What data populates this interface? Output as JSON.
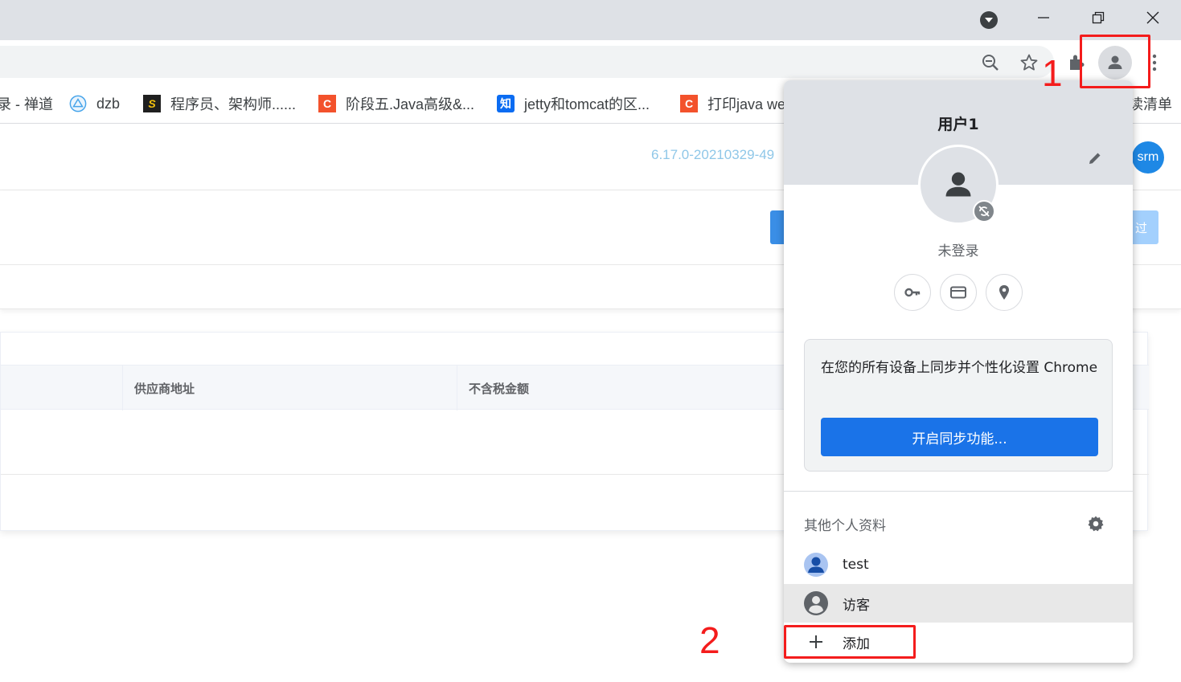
{
  "window_controls": {
    "minimize_icon": "minimize-icon",
    "restore_icon": "restore-icon",
    "close_icon": "close-icon",
    "tab_search_icon": "tab-search-icon"
  },
  "toolbar": {
    "zoom_icon": "zoom-out-icon",
    "bookmark_icon": "star-icon",
    "extensions_icon": "puzzle-icon",
    "profile_icon": "person-icon",
    "menu_icon": "kebab-menu-icon"
  },
  "bookmarks": [
    {
      "label": "录 - 禅道"
    },
    {
      "label": "dzb"
    },
    {
      "label": "程序员、架构师......"
    },
    {
      "label": "阶段五.Java高级&..."
    },
    {
      "label": "jetty和tomcat的区..."
    },
    {
      "label": "打印java we"
    },
    {
      "label": "读清单"
    }
  ],
  "page": {
    "version": "6.17.0-20210329-49",
    "user_avatar": "srm",
    "pale_button_label": "过",
    "table_headers": [
      "供应商地址",
      "不含税金额"
    ]
  },
  "profile_popup": {
    "user_name": "用户1",
    "status": "未登录",
    "sync_message": "在您的所有设备上同步并个性化设置 Chrome",
    "sync_button": "开启同步功能...",
    "other_profiles_title": "其他个人资料",
    "profiles": [
      {
        "label": "test"
      },
      {
        "label": "访客"
      }
    ],
    "add_label": "添加"
  },
  "annotations": {
    "marker_1": "1",
    "marker_2": "2",
    "color": "#f41c1c"
  },
  "colors": {
    "accent": "#1a73e8",
    "titlebar": "#dee1e6",
    "link": "#8fc7e8"
  }
}
